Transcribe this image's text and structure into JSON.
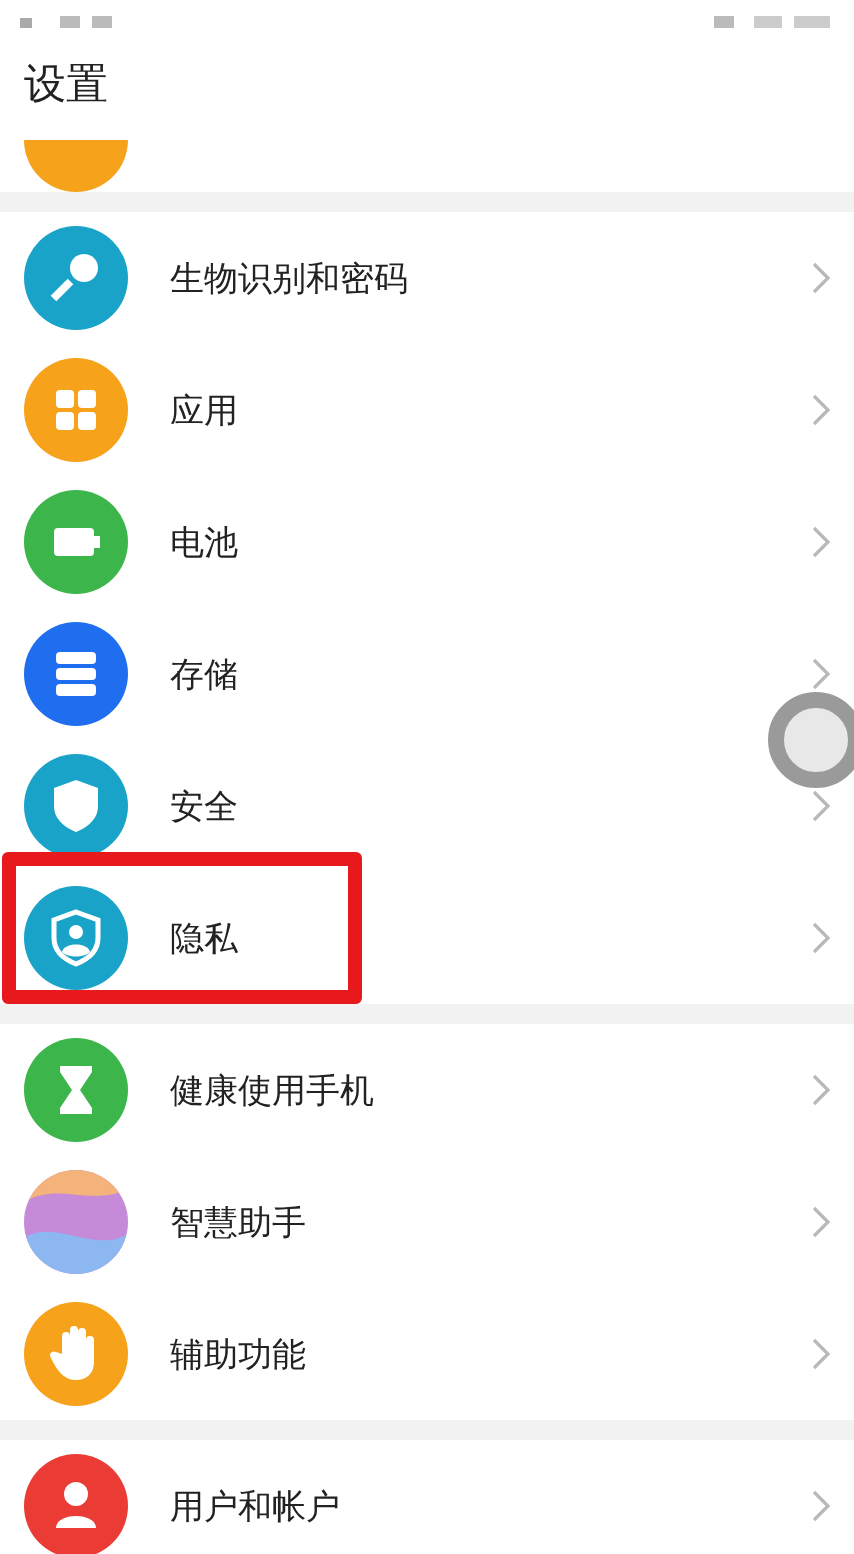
{
  "title": "设置",
  "partial_item": {
    "color": "#f7a21b"
  },
  "groups": [
    {
      "items": [
        {
          "label": "生物识别和密码",
          "kind": "key",
          "color": "#1aa3c9",
          "highlighted": false
        },
        {
          "label": "应用",
          "kind": "grid",
          "color": "#f7a21b",
          "highlighted": false
        },
        {
          "label": "电池",
          "kind": "battery",
          "color": "#3cb54a",
          "highlighted": false
        },
        {
          "label": "存储",
          "kind": "storage",
          "color": "#1f6ef0",
          "highlighted": false
        },
        {
          "label": "安全",
          "kind": "shield",
          "color": "#1aa3c9",
          "highlighted": false
        },
        {
          "label": "隐私",
          "kind": "privacy",
          "color": "#1aa3c9",
          "highlighted": true
        }
      ]
    },
    {
      "items": [
        {
          "label": "健康使用手机",
          "kind": "hourglass",
          "color": "#3cb54a",
          "highlighted": false
        },
        {
          "label": "智慧助手",
          "kind": "orb",
          "color": "#c58ad8",
          "highlighted": false
        },
        {
          "label": "辅助功能",
          "kind": "hand",
          "color": "#f7a21b",
          "highlighted": false
        }
      ]
    },
    {
      "items": [
        {
          "label": "用户和帐户",
          "kind": "user",
          "color": "#ea3b35",
          "highlighted": false
        }
      ]
    }
  ]
}
